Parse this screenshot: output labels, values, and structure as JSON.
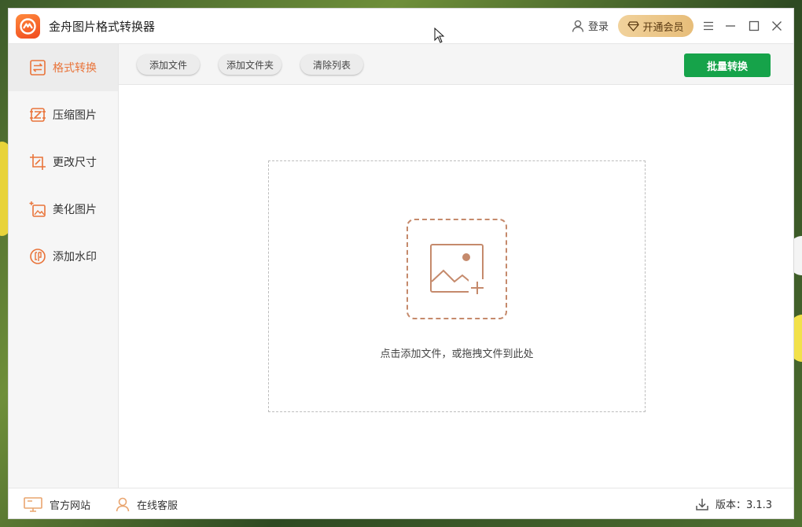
{
  "app": {
    "title": "金舟图片格式转换器"
  },
  "header": {
    "login_label": "登录",
    "vip_label": "开通会员",
    "icons": [
      "user-icon",
      "diamond-icon",
      "menu-icon",
      "minimize-icon",
      "maximize-icon",
      "close-icon"
    ]
  },
  "sidebar": {
    "items": [
      {
        "label": "格式转换",
        "icon": "format-convert-icon",
        "active": true
      },
      {
        "label": "压缩图片",
        "icon": "compress-icon",
        "active": false
      },
      {
        "label": "更改尺寸",
        "icon": "resize-icon",
        "active": false
      },
      {
        "label": "美化图片",
        "icon": "beautify-icon",
        "active": false
      },
      {
        "label": "添加水印",
        "icon": "watermark-icon",
        "active": false
      }
    ]
  },
  "toolbar": {
    "add_file_label": "添加文件",
    "add_folder_label": "添加文件夹",
    "clear_list_label": "清除列表",
    "batch_convert_label": "批量转换"
  },
  "dropzone": {
    "hint": "点击添加文件，或拖拽文件到此处"
  },
  "footer": {
    "website_label": "官方网站",
    "support_label": "在线客服",
    "version_label": "版本：3.1.3"
  },
  "colors": {
    "accent": "#e9743a",
    "primary_green": "#16a34a",
    "vip_gold": "#e7bd79",
    "dropzone_icon": "#c58a6c"
  }
}
